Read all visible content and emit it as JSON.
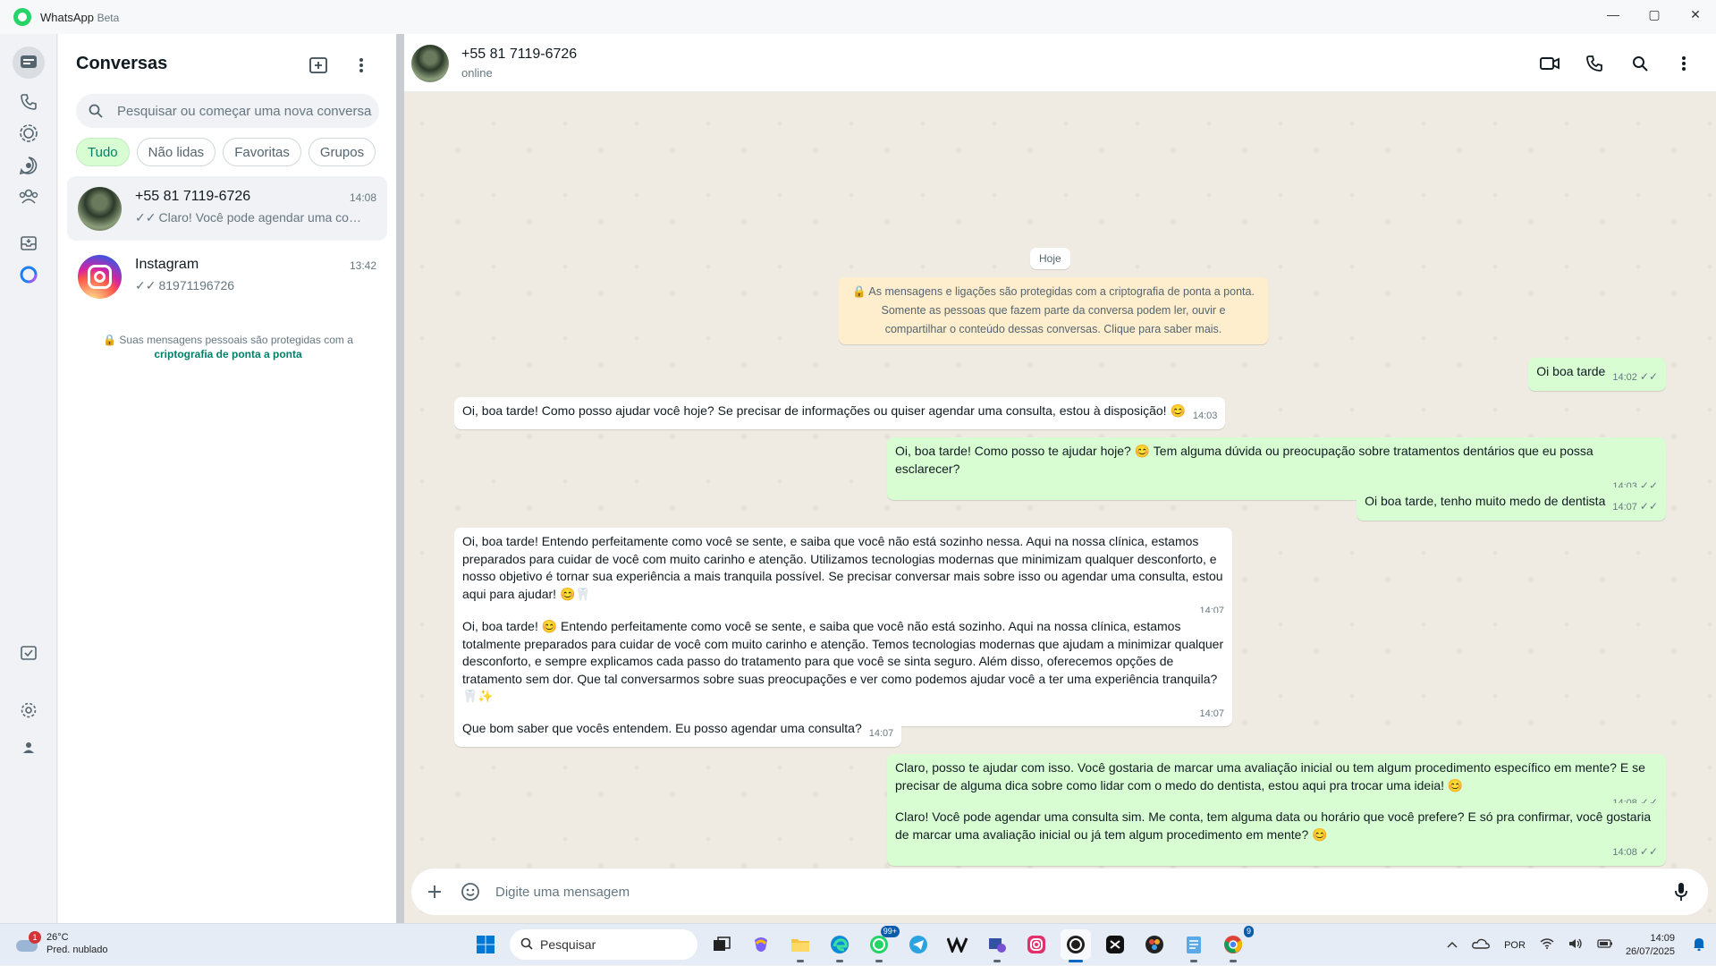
{
  "window": {
    "title": "WhatsApp",
    "title_suffix": "Beta",
    "minimize": "—",
    "maximize": "▢",
    "close": "✕"
  },
  "sidebar": {
    "title": "Conversas",
    "search_placeholder": "Pesquisar ou começar uma nova conversa",
    "filters": [
      "Tudo",
      "Não lidas",
      "Favoritas",
      "Grupos"
    ],
    "chats": [
      {
        "name": "+55 81 7119-6726",
        "time": "14:08",
        "ticks": "✓✓",
        "last": "Claro! Você pode agendar uma consulta sim. Me conta, tem alguma data ou horário"
      },
      {
        "name": "Instagram",
        "time": "13:42",
        "ticks": "✓✓",
        "last": "81971196726"
      }
    ],
    "encryption_prefix": "🔒 Suas mensagens pessoais são protegidas com a ",
    "encryption_link": "criptografia de ponta a ponta"
  },
  "chat": {
    "contact": "+55 81 7119-6726",
    "status": "online",
    "day_label": "Hoje",
    "system_note": "🔒 As mensagens e ligações são protegidas com a criptografia de ponta a ponta. Somente as pessoas que fazem parte da conversa podem ler, ouvir e compartilhar o conteúdo dessas conversas. Clique para saber mais.",
    "messages": [
      {
        "dir": "out",
        "text": "Oi boa tarde",
        "time": "14:02",
        "ticks": "✓✓"
      },
      {
        "dir": "in",
        "text": "Oi, boa tarde! Como posso ajudar você hoje? Se precisar de informações ou quiser agendar uma consulta, estou à disposição! 😊",
        "time": "14:03"
      },
      {
        "dir": "out",
        "text": "Oi, boa tarde! Como posso te ajudar hoje? 😊 Tem alguma dúvida ou preocupação sobre tratamentos dentários que eu possa esclarecer?",
        "time": "14:03",
        "ticks": "✓✓"
      },
      {
        "dir": "out",
        "text": "Oi boa tarde, tenho muito medo de dentista",
        "time": "14:07",
        "ticks": "✓✓"
      },
      {
        "dir": "in",
        "text": "Oi, boa tarde! Entendo perfeitamente como você se sente, e saiba que você não está sozinho nessa. Aqui na nossa clínica, estamos preparados para cuidar de você com muito carinho e atenção. Utilizamos tecnologias modernas que minimizam qualquer desconforto, e nosso objetivo é tornar sua experiência a mais tranquila possível. Se precisar conversar mais sobre isso ou agendar uma consulta, estou aqui para ajudar! 😊🦷",
        "time": "14:07"
      },
      {
        "dir": "in",
        "text": "Oi, boa tarde! 😊 Entendo perfeitamente como você se sente, e saiba que você não está sozinho. Aqui na nossa clínica, estamos totalmente preparados para cuidar de você com muito carinho e atenção. Temos tecnologias modernas que ajudam a minimizar qualquer desconforto, e sempre explicamos cada passo do tratamento para que você se sinta seguro. Além disso, oferecemos opções de tratamento sem dor. Que tal conversarmos sobre suas preocupações e ver como podemos ajudar você a ter uma experiência tranquila? 🦷✨",
        "time": "14:07"
      },
      {
        "dir": "in",
        "text": "Que bom saber que vocês entendem. Eu posso agendar uma consulta?",
        "time": "14:07"
      },
      {
        "dir": "out",
        "text": "Claro, posso te ajudar com isso. Você gostaria de marcar uma avaliação inicial ou tem algum procedimento específico em mente? E se precisar de alguma dica sobre como lidar com o medo do dentista, estou aqui pra trocar uma ideia! 😊",
        "time": "14:08",
        "ticks": "✓✓"
      },
      {
        "dir": "out",
        "text": "Claro! Você pode agendar uma consulta sim. Me conta, tem alguma data ou horário que você prefere? E só pra confirmar, você gostaria de marcar uma avaliação inicial ou já tem algum procedimento em mente? 😊",
        "time": "14:08",
        "ticks": "✓✓"
      }
    ],
    "composer_placeholder": "Digite uma mensagem"
  },
  "taskbar": {
    "weather_badge": "1",
    "temp": "26°C",
    "condition": "Pred. nublado",
    "search_label": "Pesquisar",
    "whatsapp_badge": "99+",
    "chrome_badge": "9",
    "lang": "POR",
    "time": "14:09",
    "date": "26/07/2025"
  },
  "icons": {
    "rail": [
      "chats-icon",
      "calls-icon",
      "status-icon",
      "channels-icon",
      "communities-icon",
      "archive-icon",
      "meta-ai-icon",
      "starred-icon",
      "settings-icon",
      "profile-icon"
    ]
  }
}
